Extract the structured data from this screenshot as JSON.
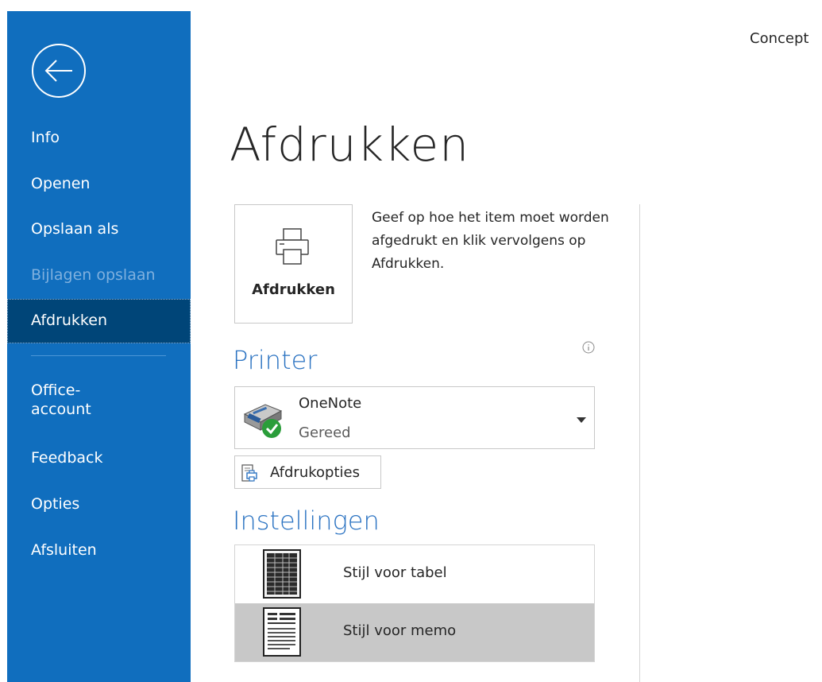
{
  "window": {
    "concept_label": "Concept"
  },
  "sidebar": {
    "back_icon": "back-arrow-circle-icon",
    "items": [
      {
        "label": "Info",
        "state": "normal"
      },
      {
        "label": "Openen",
        "state": "normal"
      },
      {
        "label": "Opslaan als",
        "state": "normal"
      },
      {
        "label": "Bijlagen opslaan",
        "state": "disabled"
      },
      {
        "label": "Afdrukken",
        "state": "selected"
      },
      {
        "label": "Office-account",
        "state": "normal"
      },
      {
        "label": "Feedback",
        "state": "normal"
      },
      {
        "label": "Opties",
        "state": "normal"
      },
      {
        "label": "Afsluiten",
        "state": "normal"
      }
    ],
    "office_account_lines": [
      "Office-",
      "account"
    ]
  },
  "main": {
    "title": "Afdrukken",
    "print_button": {
      "label": "Afdrukken",
      "icon": "printer-icon"
    },
    "print_description": "Geef op hoe het item moet worden afgedrukt en klik vervolgens op Afdrukken.",
    "printer_section": {
      "title": "Printer",
      "info_icon": "info-icon",
      "selected_printer": {
        "name": "OneNote",
        "status": "Gereed",
        "status_icon": "check-circle-icon"
      },
      "options_button": {
        "label": "Afdrukopties",
        "icon": "print-options-icon"
      }
    },
    "settings_section": {
      "title": "Instellingen",
      "styles": [
        {
          "label": "Stijl voor tabel",
          "icon": "table-style-icon",
          "selected": false
        },
        {
          "label": "Stijl voor memo",
          "icon": "memo-style-icon",
          "selected": true
        }
      ]
    }
  },
  "colors": {
    "sidebar_bg": "#106ebe",
    "sidebar_selected": "#004578",
    "accent_title": "#2b73c2",
    "check_green": "#2a9d3a"
  }
}
